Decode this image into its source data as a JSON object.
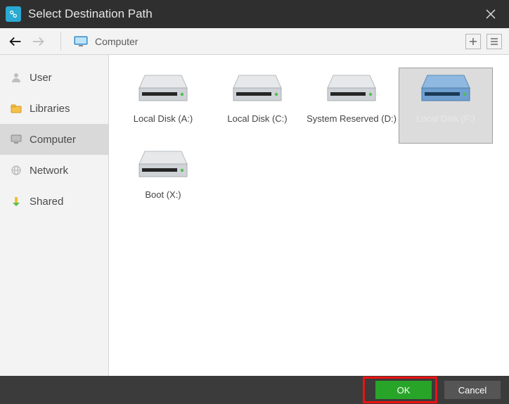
{
  "window": {
    "title": "Select Destination Path"
  },
  "toolbar": {
    "path_label": "Computer"
  },
  "sidebar": {
    "items": [
      {
        "label": "User",
        "icon": "user-icon",
        "selected": false
      },
      {
        "label": "Libraries",
        "icon": "libraries-icon",
        "selected": false
      },
      {
        "label": "Computer",
        "icon": "computer-icon",
        "selected": true
      },
      {
        "label": "Network",
        "icon": "network-icon",
        "selected": false
      },
      {
        "label": "Shared",
        "icon": "shared-icon",
        "selected": false
      }
    ]
  },
  "drives": [
    {
      "label": "Local Disk (A:)",
      "selected": false
    },
    {
      "label": "Local Disk (C:)",
      "selected": false
    },
    {
      "label": "System Reserved (D:)",
      "selected": false
    },
    {
      "label": "Local Disk (F:)",
      "selected": true
    },
    {
      "label": "Boot (X:)",
      "selected": false
    }
  ],
  "footer": {
    "ok_label": "OK",
    "cancel_label": "Cancel"
  }
}
